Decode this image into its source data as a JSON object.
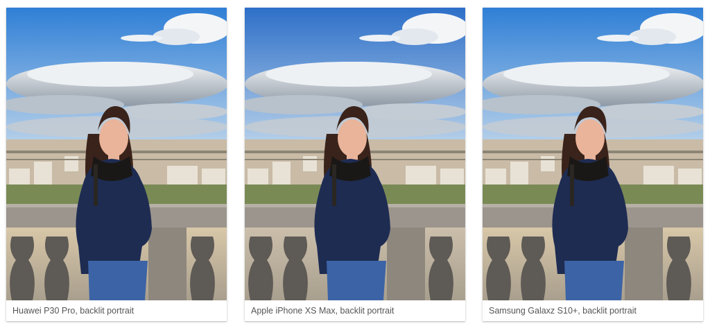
{
  "cards": [
    {
      "caption": "Huawei P30 Pro, backlit portrait"
    },
    {
      "caption": "Apple iPhone XS Max, backlit portrait"
    },
    {
      "caption": "Samsung Galaxz S10+, backlit portrait"
    }
  ],
  "colors": {
    "sky_top": "#2f7fd6",
    "sky_bottom": "#b9d2ea",
    "cloud": "#f3f5f7",
    "cloud_shadow": "#8f9aa6",
    "city": "#c9bba6",
    "jacket": "#1e2c52",
    "jeans": "#3c63a6",
    "hair": "#3a231a",
    "skin": "#e9b49a",
    "stone": "#9c958d",
    "caption_text": "#555555"
  }
}
